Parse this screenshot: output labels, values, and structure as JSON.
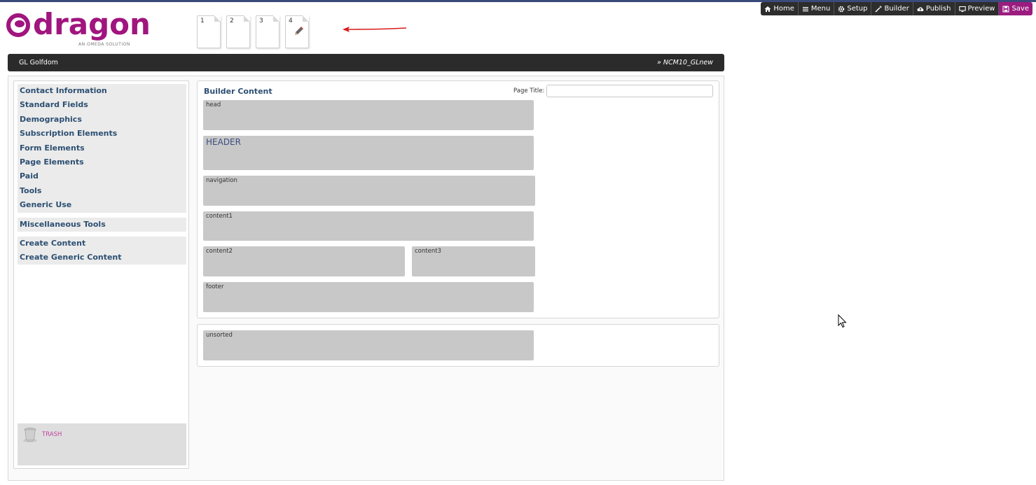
{
  "logo": {
    "word": "dragon",
    "tagline": "AN OMEDA SOLUTION"
  },
  "pages": [
    {
      "num": "1"
    },
    {
      "num": "2"
    },
    {
      "num": "3"
    },
    {
      "num": "4",
      "icon": "pencil-icon"
    }
  ],
  "toolbar": {
    "home": "Home",
    "menu": "Menu",
    "setup": "Setup",
    "builder": "Builder",
    "publish": "Publish",
    "preview": "Preview",
    "save": "Save"
  },
  "titlebar": {
    "left": "GL Golfdom",
    "right": "» NCM10_GLnew"
  },
  "sidebar": {
    "group1": [
      "Contact Information",
      "Standard Fields",
      "Demographics",
      "Subscription Elements",
      "Form Elements",
      "Page Elements",
      "Paid",
      "Tools",
      "Generic Use"
    ],
    "group2": [
      "Miscellaneous Tools"
    ],
    "group3": [
      "Create Content",
      "Create Generic Content"
    ],
    "trash": "TRASH"
  },
  "builder": {
    "title": "Builder Content",
    "page_title_label": "Page Title:",
    "page_title_value": "",
    "zones": {
      "head": "head",
      "header": "HEADER",
      "navigation": "navigation",
      "content1": "content1",
      "content2": "content2",
      "content3": "content3",
      "footer": "footer"
    },
    "unsorted": "unsorted"
  },
  "colors": {
    "brand": "#a0157e",
    "toolbar": "#2d2d2d",
    "save": "#9b1c7f",
    "link": "#2c4f72",
    "zone": "#c8c8c8"
  }
}
